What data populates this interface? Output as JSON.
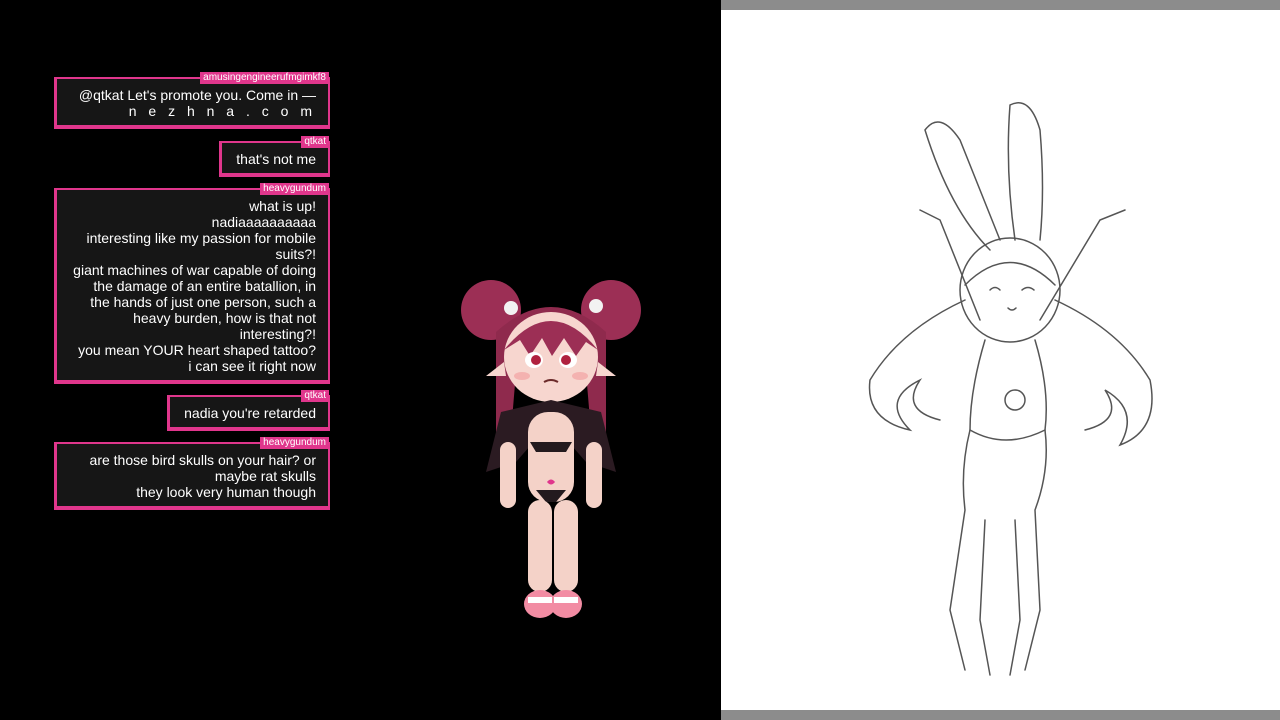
{
  "chat": {
    "messages": [
      {
        "user": "amusingengineerufmgimkf8",
        "lines": [
          "@qtkat Let's promote you. Come in —",
          "n e z h n a . c o m"
        ]
      },
      {
        "user": "qtkat",
        "lines": [
          "that's not me"
        ]
      },
      {
        "user": "heavygundum",
        "lines": [
          "what is up!",
          "nadiaaaaaaaaaa",
          "interesting like my passion for mobile",
          "suits?!",
          "giant machines of war capable of doing",
          "the damage of an entire batallion, in",
          "the hands of just one person, such a",
          "heavy burden, how is that not",
          "interesting?!",
          "you mean YOUR heart shaped tattoo?",
          "i can see it right now"
        ]
      },
      {
        "user": "qtkat",
        "lines": [
          "nadia you're retarded"
        ]
      },
      {
        "user": "heavygundum",
        "lines": [
          "are those bird skulls on your hair? or",
          "maybe rat skulls",
          "they look very human though"
        ]
      }
    ]
  },
  "colors": {
    "accent": "#e0368c",
    "bubble_bg": "#161616",
    "stream_bg": "#000000",
    "canvas_bg": "#ffffff",
    "canvas_bars": "#8c8c8c"
  }
}
